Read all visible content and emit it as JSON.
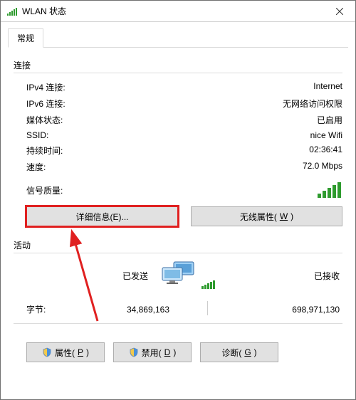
{
  "window": {
    "title": "WLAN 状态"
  },
  "tab": {
    "general": "常规"
  },
  "groups": {
    "connection": "连接",
    "activity": "活动"
  },
  "conn": {
    "ipv4_label": "IPv4 连接:",
    "ipv4_value": "Internet",
    "ipv6_label": "IPv6 连接:",
    "ipv6_value": "无网络访问权限",
    "media_label": "媒体状态:",
    "media_value": "已启用",
    "ssid_label": "SSID:",
    "ssid_value": "nice Wifi",
    "duration_label": "持续时间:",
    "duration_value": "02:36:41",
    "speed_label": "速度:",
    "speed_value": "72.0 Mbps",
    "signal_label": "信号质量:"
  },
  "buttons": {
    "details": "详细信息(E)...",
    "wireless_props_pre": "无线属性(",
    "wireless_props_mn": "W",
    "wireless_props_post": ")",
    "props_pre": "属性(",
    "props_mn": "P",
    "props_post": ")",
    "disable_pre": "禁用(",
    "disable_mn": "D",
    "disable_post": ")",
    "diagnose_pre": "诊断(",
    "diagnose_mn": "G",
    "diagnose_post": ")"
  },
  "activity": {
    "sent": "已发送",
    "received": "已接收",
    "bytes_label": "字节:",
    "bytes_sent": "34,869,163",
    "bytes_recv": "698,971,130"
  }
}
